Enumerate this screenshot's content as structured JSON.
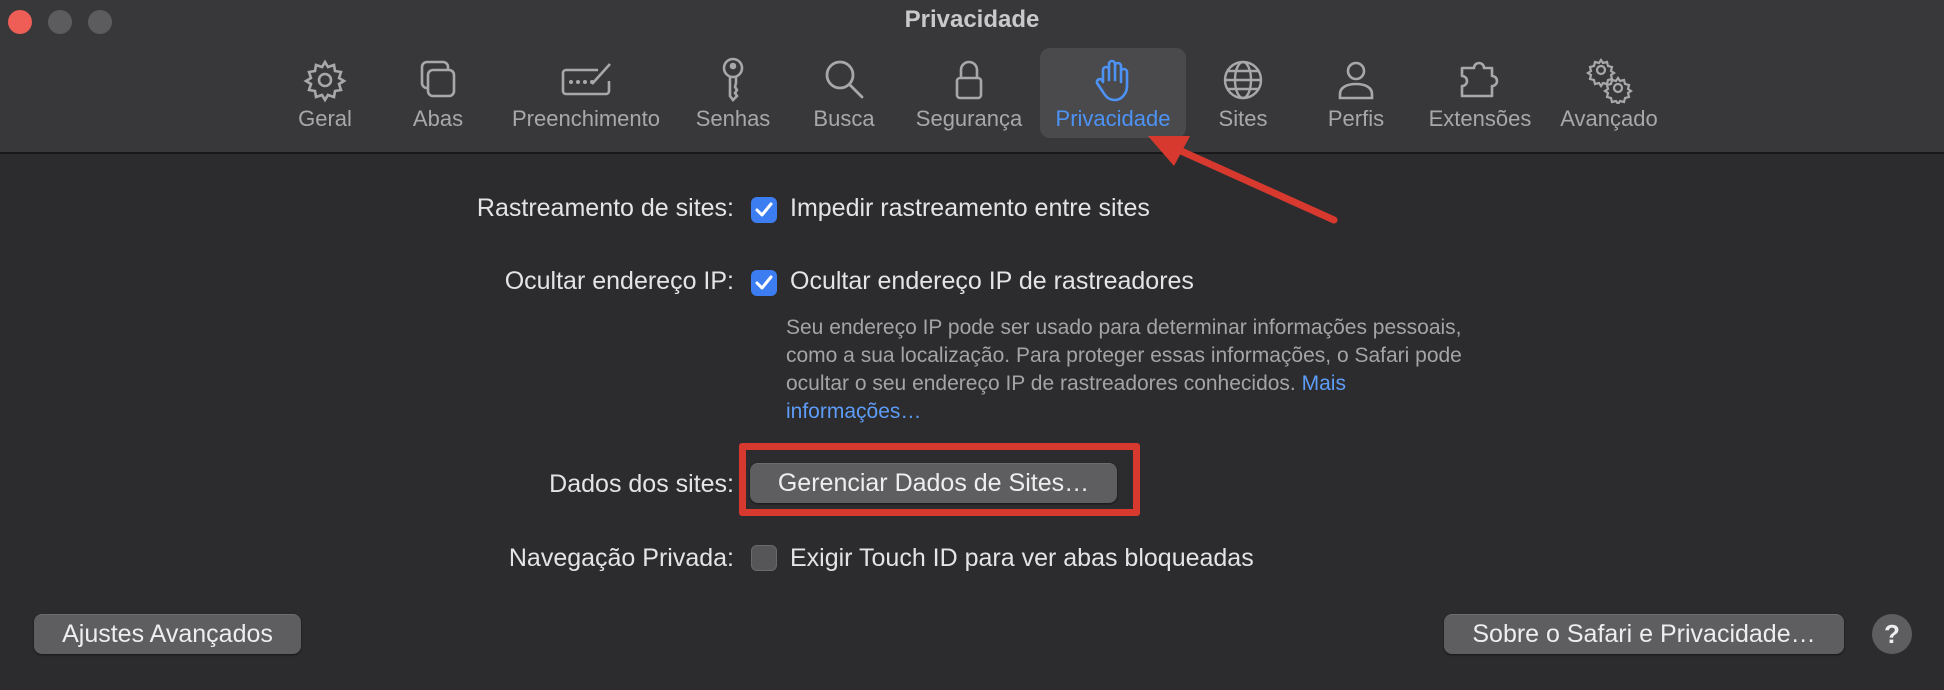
{
  "window": {
    "title": "Privacidade",
    "traffic_lights": [
      "close",
      "minimize",
      "zoom"
    ]
  },
  "toolbar": {
    "tabs": [
      {
        "label": "Geral",
        "icon": "gear-icon"
      },
      {
        "label": "Abas",
        "icon": "tabs-icon"
      },
      {
        "label": "Preenchimento",
        "icon": "autofill-icon"
      },
      {
        "label": "Senhas",
        "icon": "key-icon"
      },
      {
        "label": "Busca",
        "icon": "search-icon"
      },
      {
        "label": "Segurança",
        "icon": "lock-icon"
      },
      {
        "label": "Privacidade",
        "icon": "hand-icon",
        "selected": true
      },
      {
        "label": "Sites",
        "icon": "globe-icon"
      },
      {
        "label": "Perfis",
        "icon": "person-icon"
      },
      {
        "label": "Extensões",
        "icon": "puzzle-icon"
      },
      {
        "label": "Avançado",
        "icon": "gears-icon"
      }
    ]
  },
  "settings": {
    "tracking": {
      "label": "Rastreamento de sites:",
      "option": "Impedir rastreamento entre sites",
      "checked": true
    },
    "hide_ip": {
      "label": "Ocultar endereço IP:",
      "option": "Ocultar endereço IP de rastreadores",
      "checked": true,
      "description": "Seu endereço IP pode ser usado para determinar informações pessoais, como a sua localização. Para proteger essas informações, o Safari pode ocultar o seu endereço IP de rastreadores conhecidos.",
      "more_link": "Mais informações…"
    },
    "site_data": {
      "label": "Dados dos sites:",
      "button": "Gerenciar Dados de Sites…"
    },
    "private_browsing": {
      "label": "Navegação Privada:",
      "option": "Exigir Touch ID para ver abas bloqueadas",
      "checked": false
    }
  },
  "footer": {
    "advanced_button": "Ajustes Avançados",
    "about_button": "Sobre o Safari e Privacidade…",
    "help_button": "?"
  },
  "colors": {
    "accent": "#3c7ef2",
    "selected_tab_text": "#4d93f5",
    "annotation_red": "#d7392f"
  }
}
